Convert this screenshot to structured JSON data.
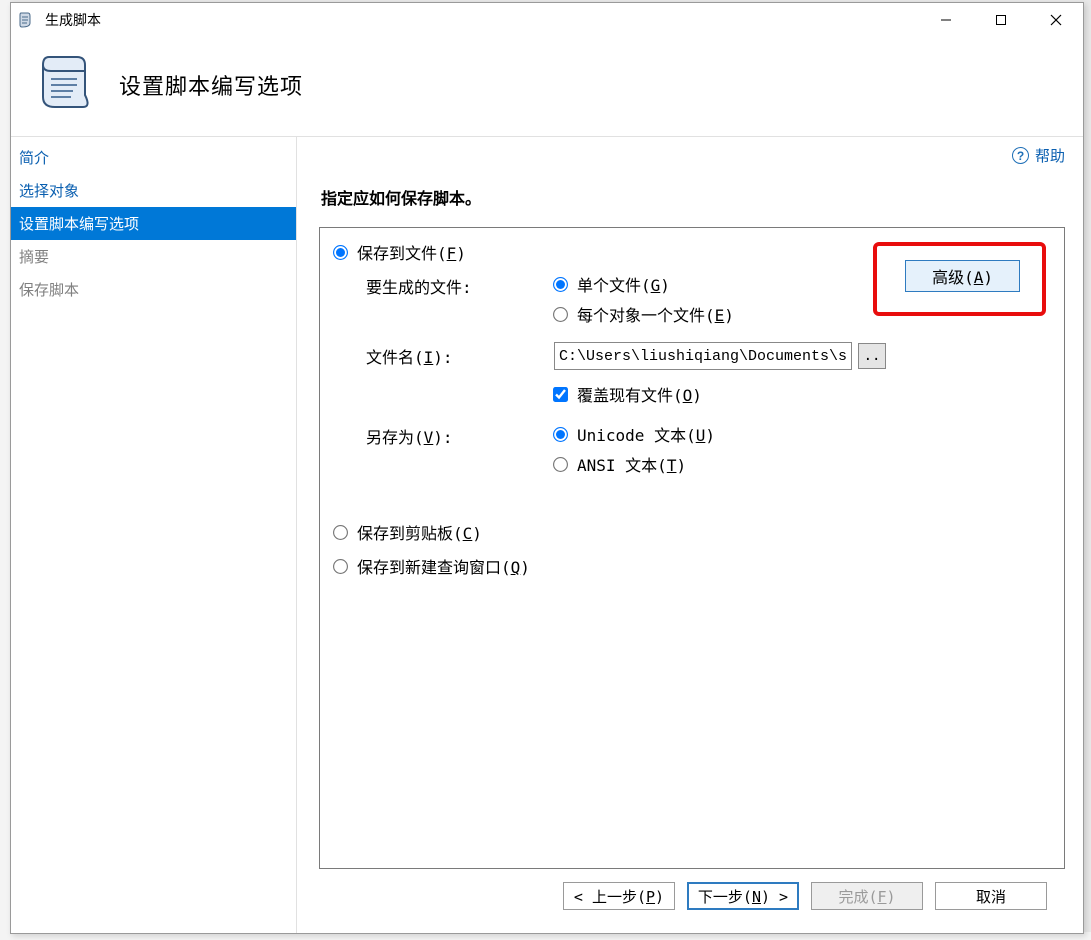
{
  "window": {
    "title": "生成脚本"
  },
  "header": {
    "title": "设置脚本编写选项"
  },
  "help_label": "帮助",
  "sidebar": {
    "items": [
      {
        "label": "简介",
        "state": "link"
      },
      {
        "label": "选择对象",
        "state": "link"
      },
      {
        "label": "设置脚本编写选项",
        "state": "selected"
      },
      {
        "label": "摘要",
        "state": "disabled"
      },
      {
        "label": "保存脚本",
        "state": "disabled"
      }
    ]
  },
  "content": {
    "heading": "指定应如何保存脚本。",
    "advanced_btn_prefix": "高级(",
    "advanced_btn_hotkey": "A",
    "advanced_btn_suffix": ")",
    "save_to_file": {
      "label_prefix": "保存到文件(",
      "label_hotkey": "F",
      "label_suffix": ")",
      "files_to_generate_label": "要生成的文件:",
      "option_single_prefix": "单个文件(",
      "option_single_hotkey": "G",
      "option_single_suffix": ")",
      "option_per_object_prefix": "每个对象一个文件(",
      "option_per_object_hotkey": "E",
      "option_per_object_suffix": ")",
      "filename_label_prefix": "文件名(",
      "filename_label_hotkey": "I",
      "filename_label_suffix": "):",
      "filename_value": "C:\\Users\\liushiqiang\\Documents\\scrip",
      "overwrite_prefix": "覆盖现有文件(",
      "overwrite_hotkey": "O",
      "overwrite_suffix": ")",
      "saveas_label_prefix": "另存为(",
      "saveas_label_hotkey": "V",
      "saveas_label_suffix": "):",
      "saveas_unicode_prefix": "Unicode 文本(",
      "saveas_unicode_hotkey": "U",
      "saveas_unicode_suffix": ")",
      "saveas_ansi_prefix": "ANSI 文本(",
      "saveas_ansi_hotkey": "T",
      "saveas_ansi_suffix": ")"
    },
    "save_to_clipboard_prefix": "保存到剪贴板(",
    "save_to_clipboard_hotkey": "C",
    "save_to_clipboard_suffix": ")",
    "save_to_new_query_prefix": "保存到新建查询窗口(",
    "save_to_new_query_hotkey": "Q",
    "save_to_new_query_suffix": ")"
  },
  "footer": {
    "prev_text": "< 上一步(",
    "prev_hotkey": "P",
    "prev_close": ")",
    "next_text": "下一步(",
    "next_hotkey": "N",
    "next_close": ") >",
    "finish_text": "完成(",
    "finish_hotkey": "F",
    "finish_close": ")",
    "cancel_text": "取消"
  }
}
